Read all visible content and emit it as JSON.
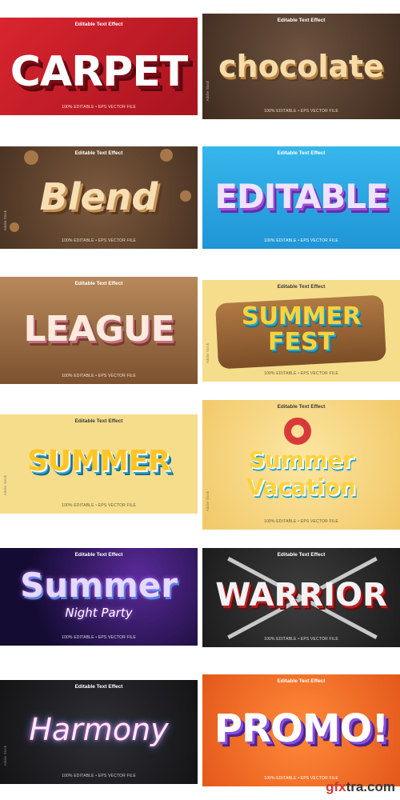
{
  "tiles": [
    {
      "title": "CARPET",
      "top": "Editable Text Effect",
      "bottom": "100% EDITABLE • EPS VECTOR FILE"
    },
    {
      "title": "chocolate",
      "top": "Editable Text Effect",
      "bottom": "100% EDITABLE • EPS VECTOR FILE"
    },
    {
      "title": "Blend",
      "top": "Editable Text Effect",
      "bottom": "100% EDITABLE • EPS VECTOR FILE"
    },
    {
      "title": "EDITABLE",
      "top": "Editable Text Effect",
      "bottom": "100% EDITABLE • EPS VECTOR FILE"
    },
    {
      "title": "LEAGUE",
      "top": "Editable Text Effect",
      "bottom": "100% EDITABLE • EPS VECTOR FILE"
    },
    {
      "title": "SUMMER",
      "title2": "FEST",
      "top": "Editable Text Effect",
      "bottom": "100% EDITABLE • EPS VECTOR FILE"
    },
    {
      "title": "SUMMER",
      "top": "Editable Text Effect",
      "bottom": "100% EDITABLE • EPS VECTOR FILE"
    },
    {
      "title": "Summer",
      "title2": "Vacation",
      "top": "Editable Text Effect",
      "bottom": "100% EDITABLE • EPS VECTOR FILE"
    },
    {
      "title": "Summer",
      "title2": "Night Party",
      "top": "Editable Text Effect",
      "bottom": "100% EDITABLE • EPS VECTOR FILE"
    },
    {
      "title": "WARRIOR",
      "top": "Editable Text Effect",
      "bottom": "100% EDITABLE • EPS VECTOR FILE"
    },
    {
      "title": "Harmony",
      "top": "Editable Text Effect",
      "bottom": "100% EDITABLE • EPS VECTOR FILE"
    },
    {
      "title": "PROMO!",
      "top": "Editable Text Effect",
      "bottom": "100% EDITABLE • EPS VECTOR FILE"
    }
  ],
  "side_label": "Adobe Stock",
  "watermark": {
    "brand": "gfx",
    "rest": "tra.com"
  },
  "colors": {
    "carpet_bg": "#c8202c",
    "chocolate_bg": "#5b4230",
    "blend_bg": "#6a4a30",
    "editable_bg": "#2aa7e0",
    "league_bg": "#8a5a30",
    "summer_bg": "#f4d98a",
    "night_bg": "#1a1040",
    "warrior_bg": "#2b2b2b",
    "harmony_bg": "#1b1b1f",
    "promo_bg": "#f06a1a"
  }
}
